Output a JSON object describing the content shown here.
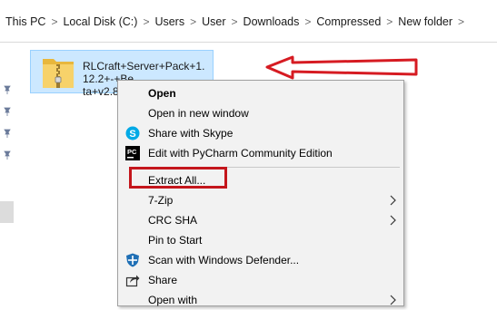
{
  "breadcrumb": [
    "This PC",
    "Local Disk (C:)",
    "Users",
    "User",
    "Downloads",
    "Compressed",
    "New folder"
  ],
  "file": {
    "name_line1": "RLCraft+Server+Pack+1.12.2+-+Be",
    "name_line2": "ta+v2.8.2",
    "icon": "zip-folder-icon"
  },
  "context_menu": {
    "items": [
      {
        "label": "Open",
        "bold": true,
        "icon": null
      },
      {
        "label": "Open in new window",
        "icon": null
      },
      {
        "label": "Share with Skype",
        "icon": "skype-icon"
      },
      {
        "label": "Edit with PyCharm Community Edition",
        "icon": "pycharm-icon"
      },
      {
        "label": "Extract All...",
        "icon": null,
        "highlighted": true
      },
      {
        "label": "7-Zip",
        "icon": null,
        "submenu": true
      },
      {
        "label": "CRC SHA",
        "icon": null,
        "submenu": true
      },
      {
        "label": "Pin to Start",
        "icon": null
      },
      {
        "label": "Scan with Windows Defender...",
        "icon": "windows-defender-icon"
      },
      {
        "label": "Share",
        "icon": "share-icon"
      },
      {
        "label": "Open with",
        "icon": null,
        "submenu": true
      }
    ]
  },
  "colors": {
    "annotation_red": "#c4161c",
    "selection_fill": "#cce8ff",
    "menu_bg": "#f2f2f2"
  }
}
